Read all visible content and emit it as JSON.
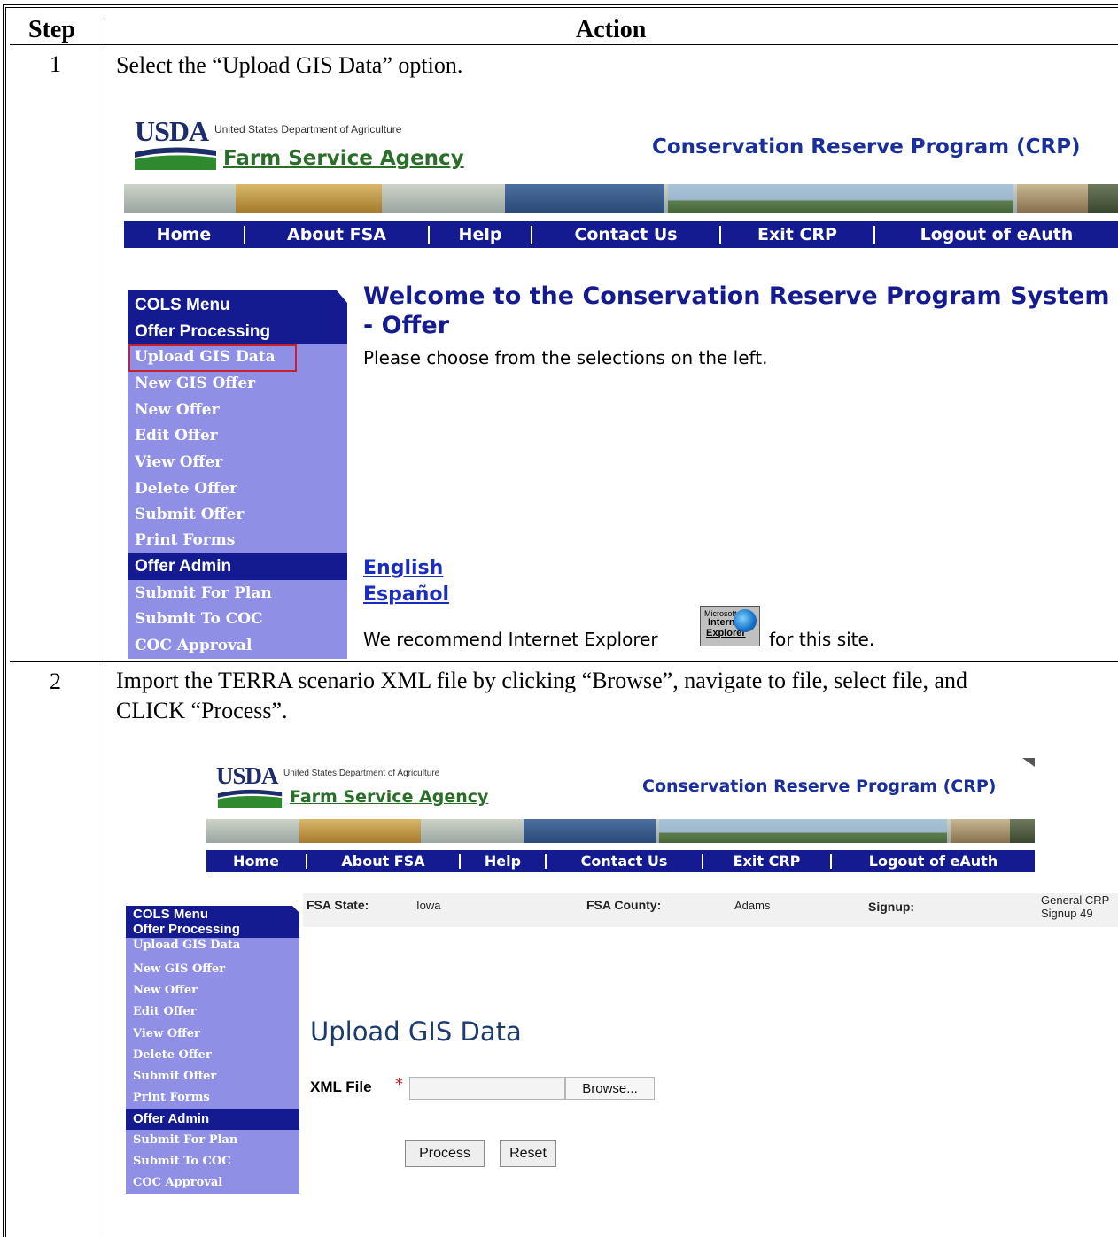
{
  "table": {
    "headers": {
      "step": "Step",
      "action": "Action"
    },
    "rows": [
      {
        "step": "1",
        "instruction": "Select the “Upload GIS Data” option."
      },
      {
        "step": "2",
        "instruction": "Import the TERRA scenario XML file by clicking “Browse”, navigate to file, select file, and CLICK “Process”."
      }
    ]
  },
  "header": {
    "usda": "USDA",
    "department": "United States Department of Agriculture",
    "agency": "Farm Service Agency",
    "program": "Conservation Reserve Program (CRP)"
  },
  "nav": [
    "Home",
    "About FSA",
    "Help",
    "Contact Us",
    "Exit CRP",
    "Logout of eAuth"
  ],
  "menu": {
    "title": "COLS Menu",
    "offer_processing": "Offer Processing",
    "processing_items": [
      "Upload GIS Data",
      "New GIS Offer",
      "New Offer",
      "Edit Offer",
      "View Offer",
      "Delete Offer",
      "Submit Offer",
      "Print Forms"
    ],
    "offer_admin": "Offer Admin",
    "admin_items": [
      "Submit For Plan",
      "Submit To COC",
      "COC Approval"
    ]
  },
  "screen1": {
    "welcome_line1": "Welcome to the Conservation Reserve Program System",
    "welcome_line2": "- Offer",
    "subtitle": "Please choose from the selections on the left.",
    "lang_english": "English",
    "lang_spanish": "Español",
    "recommend_before": "We recommend Internet Explorer",
    "recommend_after": "for this site.",
    "ie_logo_line1": "Microsoft",
    "ie_logo_line2": "Internet",
    "ie_logo_line3": "Explorer"
  },
  "screen2": {
    "fsa_state_label": "FSA State:",
    "fsa_state_value": "Iowa",
    "fsa_county_label": "FSA County:",
    "fsa_county_value": "Adams",
    "signup_label": "Signup:",
    "signup_value_line1": "General CRP",
    "signup_value_line2": "Signup 49",
    "page_title": "Upload GIS Data",
    "xml_file_label": "XML File",
    "required_mark": "*",
    "browse_label": "Browse...",
    "process_label": "Process",
    "reset_label": "Reset"
  },
  "colors": {
    "nav_blue": "#141a8f",
    "menu_purple": "#8f8fe6",
    "highlight_red": "#c8202a",
    "agency_green": "#2a6e2a"
  }
}
